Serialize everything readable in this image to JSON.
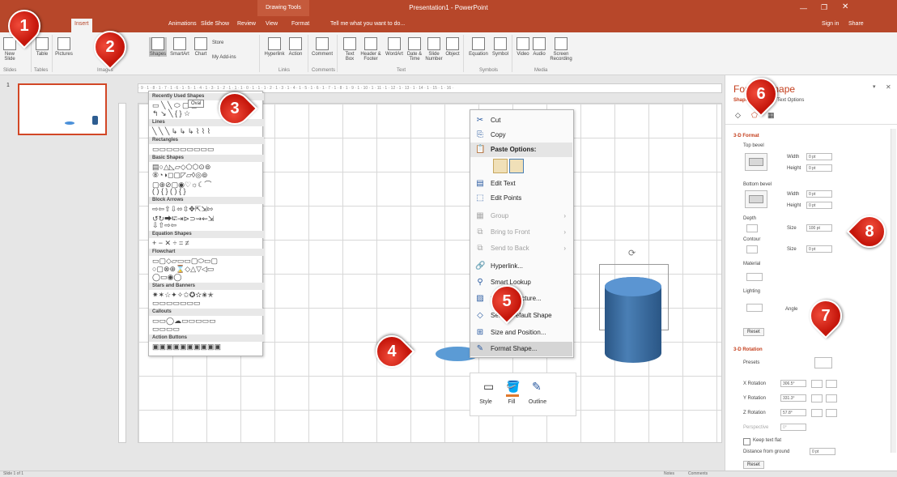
{
  "window": {
    "title": "Presentation1 - PowerPoint",
    "contextual_group": "Drawing Tools",
    "sign_in": "Sign in",
    "share": "Share"
  },
  "tabs": [
    "Insert",
    "Animations",
    "Slide Show",
    "Review",
    "View",
    "Format"
  ],
  "tell_me": "Tell me what you want to do...",
  "ribbon": {
    "buttons": [
      {
        "label": "New Slide"
      },
      {
        "label": "Table"
      },
      {
        "label": "Pictures"
      },
      {
        "label": "Shapes"
      },
      {
        "label": "SmartArt"
      },
      {
        "label": "Chart"
      },
      {
        "label": "Store"
      },
      {
        "label": "My Add-ins"
      },
      {
        "label": "Hyperlink"
      },
      {
        "label": "Action"
      },
      {
        "label": "Comment"
      },
      {
        "label": "Text Box"
      },
      {
        "label": "Header & Footer"
      },
      {
        "label": "WordArt"
      },
      {
        "label": "Date & Time"
      },
      {
        "label": "Slide Number"
      },
      {
        "label": "Object"
      },
      {
        "label": "Equation"
      },
      {
        "label": "Symbol"
      },
      {
        "label": "Video"
      },
      {
        "label": "Audio"
      },
      {
        "label": "Screen Recording"
      }
    ],
    "groups": [
      "Slides",
      "Tables",
      "Images",
      "Links",
      "Comments",
      "Text",
      "Symbols",
      "Media"
    ]
  },
  "shapes_gallery": {
    "sections": [
      "Recently Used Shapes",
      "Lines",
      "Rectangles",
      "Basic Shapes",
      "Block Arrows",
      "Equation Shapes",
      "Flowchart",
      "Stars and Banners",
      "Callouts",
      "Action Buttons"
    ],
    "tooltip": "Oval"
  },
  "context_menu": {
    "items": [
      {
        "label": "Cut",
        "icon": "scissors-icon",
        "enabled": true
      },
      {
        "label": "Copy",
        "icon": "copy-icon",
        "enabled": true
      },
      {
        "label": "Paste Options:",
        "icon": "paste-icon",
        "enabled": true
      },
      {
        "label": "Edit Text",
        "icon": "edit-text-icon",
        "enabled": true
      },
      {
        "label": "Edit Points",
        "icon": "edit-points-icon",
        "enabled": true
      },
      {
        "label": "Group",
        "icon": "group-icon",
        "enabled": false
      },
      {
        "label": "Bring to Front",
        "icon": "bring-front-icon",
        "enabled": false
      },
      {
        "label": "Send to Back",
        "icon": "send-back-icon",
        "enabled": false
      },
      {
        "label": "Hyperlink...",
        "icon": "hyperlink-icon",
        "enabled": true
      },
      {
        "label": "Smart Lookup",
        "icon": "lookup-icon",
        "enabled": true
      },
      {
        "label": "Save as Picture...",
        "icon": "picture-icon",
        "enabled": true
      },
      {
        "label": "Set as Default Shape",
        "icon": "default-icon",
        "enabled": true
      },
      {
        "label": "Size and Position...",
        "icon": "size-icon",
        "enabled": true
      },
      {
        "label": "Format Shape...",
        "icon": "format-shape-icon",
        "enabled": true
      }
    ]
  },
  "mini_toolbar": {
    "items": [
      "Style",
      "Fill",
      "Outline"
    ]
  },
  "format_pane": {
    "title": "Format Shape",
    "tabs": [
      "Shape Options",
      "Text Options"
    ],
    "section_3d_format": "3-D Format",
    "top_bevel": "Top bevel",
    "bottom_bevel": "Bottom bevel",
    "width_label": "Width",
    "height_label": "Height",
    "bevel_values": [
      "0 pt",
      "0 pt",
      "0 pt",
      "0 pt"
    ],
    "depth_label": "Depth",
    "size_label": "Size",
    "depth_size": "100 pt",
    "contour_label": "Contour",
    "contour_size": "0 pt",
    "material_label": "Material",
    "lighting_label": "Lighting",
    "angle_label": "Angle",
    "reset": "Reset",
    "section_3d_rotation": "3-D Rotation",
    "presets": "Presets",
    "x_rotation_label": "X Rotation",
    "x_rotation": "306.5°",
    "y_rotation_label": "Y Rotation",
    "y_rotation": "331.3°",
    "z_rotation_label": "Z Rotation",
    "z_rotation": "57.8°",
    "perspective_label": "Perspective",
    "perspective": "0°",
    "keep_text_flat": "Keep text flat",
    "distance_label": "Distance from ground",
    "distance": "0 pt",
    "reset2": "Reset"
  },
  "status": {
    "slide": "Slide 1 of 1",
    "notes": "Notes",
    "comments": "Comments"
  },
  "callouts": [
    "1",
    "2",
    "3",
    "4",
    "5",
    "6",
    "7",
    "8"
  ],
  "colors": {
    "accent": "#b7472a",
    "callout": "#d81b0f",
    "shape_blue": "#3f6fa8"
  }
}
